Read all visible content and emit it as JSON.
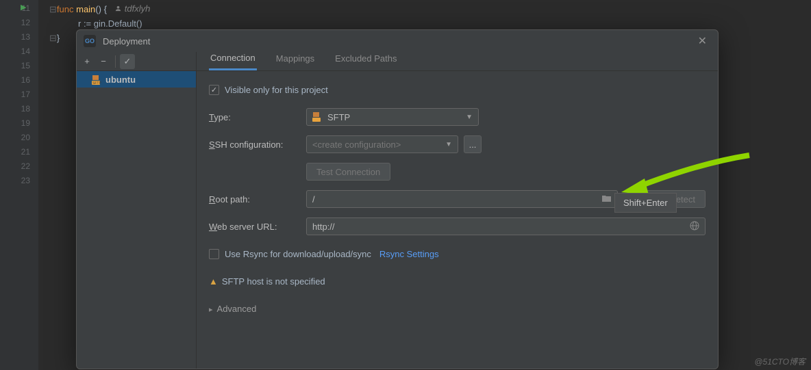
{
  "editor": {
    "lines": [
      "11",
      "12",
      "13",
      "14",
      "15",
      "16",
      "17",
      "18",
      "19",
      "20",
      "21",
      "22",
      "23"
    ],
    "code_kw": "func",
    "code_fn": "main",
    "code_rest_1": "() {",
    "author_name": "tdfxlyh",
    "line2": "r := gin.Default()",
    "line22": "}"
  },
  "dialog": {
    "title": "Deployment",
    "toolbar": {
      "add": "+",
      "remove": "−",
      "check": "✓"
    },
    "tree": {
      "item1": "ubuntu"
    },
    "tabs": {
      "connection": "Connection",
      "mappings": "Mappings",
      "excluded": "Excluded Paths"
    },
    "visible_only": "Visible only for this project",
    "type_label": "Type:",
    "type_value": "SFTP",
    "ssh_label": "SSH configuration:",
    "ssh_placeholder": "<create configuration>",
    "ellipsis": "...",
    "test_btn": "Test Connection",
    "tooltip": "Shift+Enter",
    "root_label": "Root path:",
    "root_value": "/",
    "autodetect": "Autodetect",
    "web_label": "Web server URL:",
    "web_value": "http://",
    "rsync_check": "Use Rsync for download/upload/sync",
    "rsync_link": "Rsync Settings",
    "warning": "SFTP host is not specified",
    "advanced": "Advanced"
  },
  "watermark": "@51CTO博客"
}
